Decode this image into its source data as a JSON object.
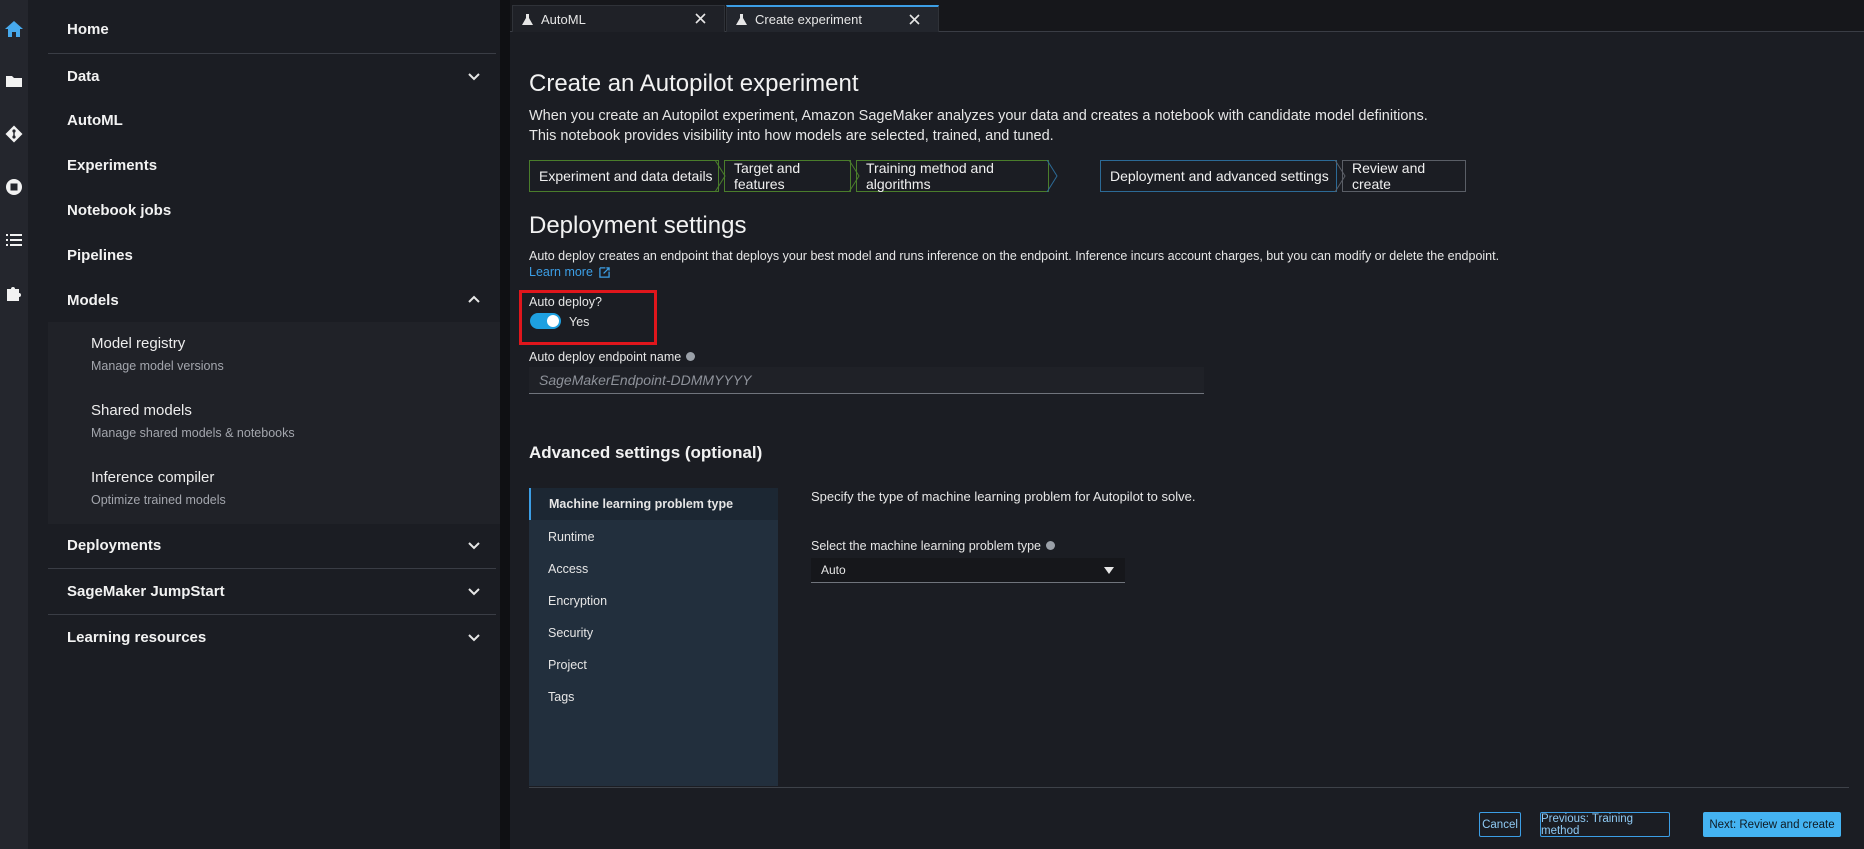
{
  "nav": {
    "home": "Home",
    "data": "Data",
    "automl": "AutoML",
    "experiments": "Experiments",
    "notebook_jobs": "Notebook jobs",
    "pipelines": "Pipelines",
    "models": "Models",
    "models_sub": [
      {
        "title": "Model registry",
        "desc": "Manage model versions"
      },
      {
        "title": "Shared models",
        "desc": "Manage shared models & notebooks"
      },
      {
        "title": "Inference compiler",
        "desc": "Optimize trained models"
      }
    ],
    "deployments": "Deployments",
    "jumpstart": "SageMaker JumpStart",
    "learning": "Learning resources"
  },
  "tabs": [
    {
      "label": "AutoML"
    },
    {
      "label": "Create experiment"
    }
  ],
  "page": {
    "title": "Create an Autopilot experiment",
    "desc_line1": "When you create an Autopilot experiment, Amazon SageMaker analyzes your data and creates a notebook with candidate model definitions.",
    "desc_line2": "This notebook provides visibility into how models are selected, trained, and tuned."
  },
  "steps": [
    {
      "label": "Experiment and data details"
    },
    {
      "label": "Target and features"
    },
    {
      "label": "Training method and algorithms"
    },
    {
      "label": "Deployment and advanced settings"
    },
    {
      "label": "Review and create"
    }
  ],
  "deployment": {
    "heading": "Deployment settings",
    "info": "Auto deploy creates an endpoint that deploys your best model and runs inference on the endpoint. Inference incurs account charges, but you can modify or delete the endpoint.",
    "learn_more": "Learn more",
    "auto_deploy_label": "Auto deploy?",
    "auto_deploy_value": "Yes",
    "endpoint_label": "Auto deploy endpoint name",
    "endpoint_placeholder": "SageMakerEndpoint-DDMMYYYY"
  },
  "advanced": {
    "heading": "Advanced settings (optional)",
    "items": [
      "Machine learning problem type",
      "Runtime",
      "Access",
      "Encryption",
      "Security",
      "Project",
      "Tags"
    ],
    "desc": "Specify the type of machine learning problem for Autopilot to solve.",
    "select_label": "Select the machine learning problem type",
    "select_value": "Auto"
  },
  "buttons": {
    "cancel": "Cancel",
    "previous": "Previous: Training method",
    "next": "Next: Review and create"
  },
  "colors": {
    "accent": "#3c9ee5",
    "highlight": "#e0161c",
    "completed_step": "#4a7d2b"
  }
}
